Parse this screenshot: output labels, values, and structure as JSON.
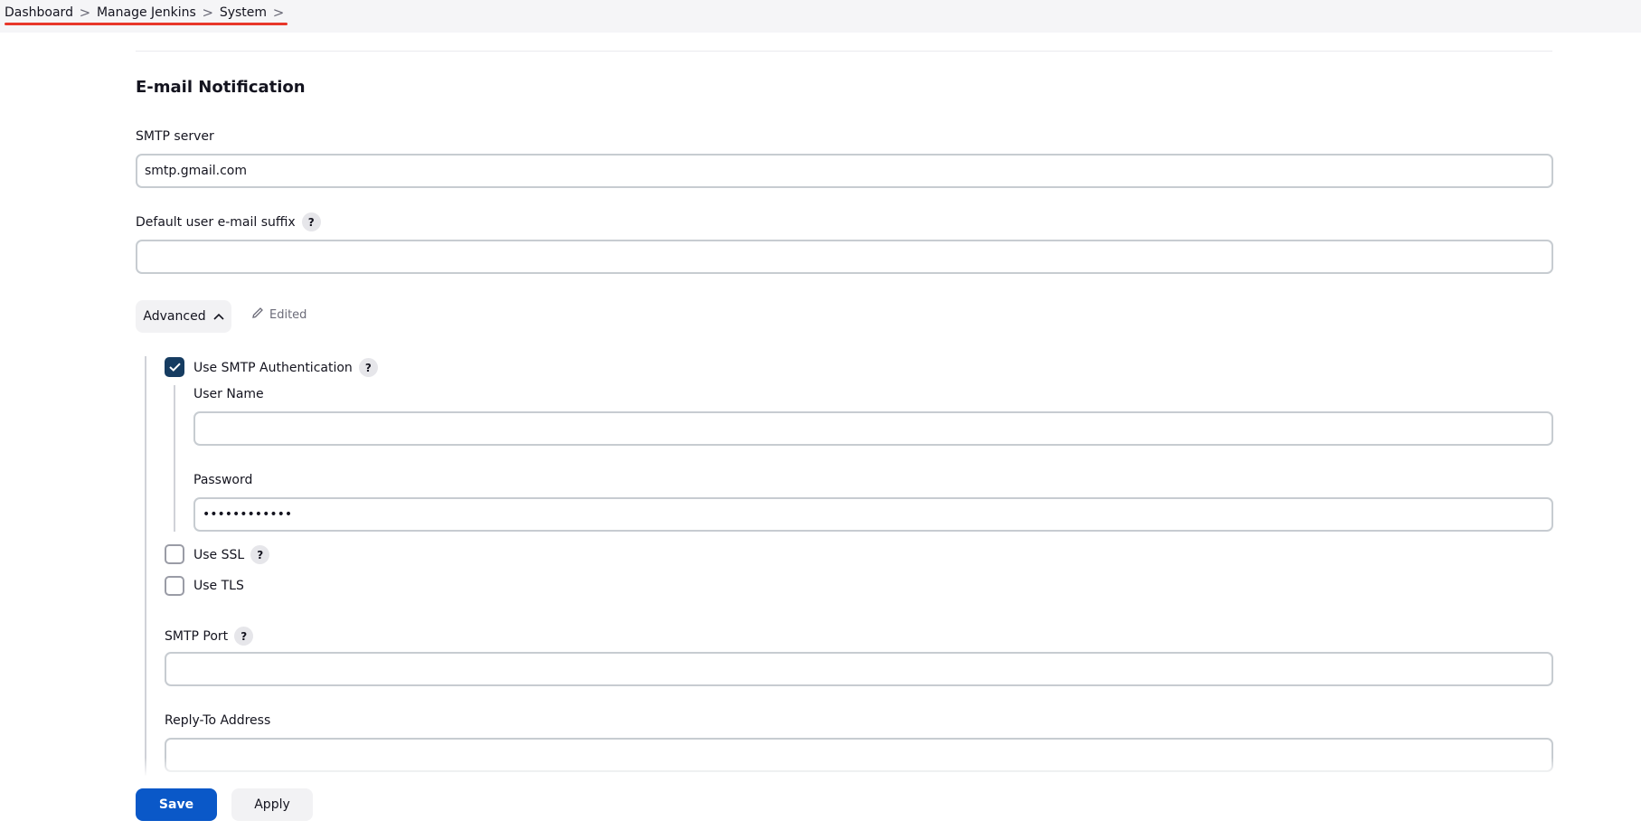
{
  "breadcrumb": {
    "items": [
      "Dashboard",
      "Manage Jenkins",
      "System"
    ],
    "separator": ">",
    "underline_color": "#e8372a"
  },
  "section": {
    "title": "E-mail Notification"
  },
  "smtp_server": {
    "label": "SMTP server",
    "value": "smtp.gmail.com"
  },
  "default_suffix": {
    "label": "Default user e-mail suffix",
    "help": "?",
    "value": ""
  },
  "advanced": {
    "label": "Advanced",
    "chevron_icon": "chevron-up-icon",
    "edited_label": "Edited",
    "edited_icon": "pencil-icon"
  },
  "smtp_auth": {
    "label": "Use SMTP Authentication",
    "help": "?",
    "checked": true,
    "user_name_label": "User Name",
    "user_name_value": "",
    "password_label": "Password",
    "password_value": "••••••••••••"
  },
  "ssl": {
    "label": "Use SSL",
    "help": "?",
    "checked": false
  },
  "tls": {
    "label": "Use TLS",
    "checked": false
  },
  "smtp_port": {
    "label": "SMTP Port",
    "help": "?",
    "value": ""
  },
  "reply_to": {
    "label": "Reply-To Address",
    "value": ""
  },
  "actions": {
    "save_label": "Save",
    "apply_label": "Apply",
    "save_color": "#0a58c8"
  },
  "colors": {
    "checkbox_checked": "#163c61"
  }
}
